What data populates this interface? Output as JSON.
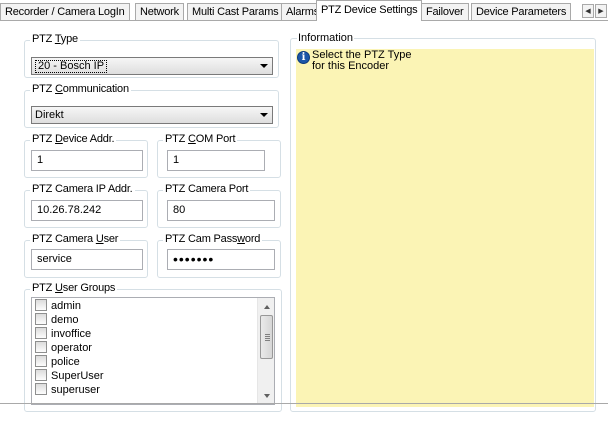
{
  "tabs": [
    {
      "label": "Recorder / Camera LogIn",
      "active": false
    },
    {
      "label": "Network",
      "active": false
    },
    {
      "label": "Multi Cast Params",
      "active": false
    },
    {
      "label": "Alarms",
      "active": false
    },
    {
      "label": "PTZ Device Settings",
      "active": true
    },
    {
      "label": "Failover",
      "active": false
    },
    {
      "label": "Device Parameters",
      "active": false
    }
  ],
  "ptz_type": {
    "title_pre": "PTZ ",
    "title_key": "T",
    "title_post": "ype",
    "value": "20 - Bosch IP"
  },
  "ptz_communication": {
    "title_pre": "PTZ ",
    "title_key": "C",
    "title_post": "ommunication",
    "value": "Direkt"
  },
  "ptz_device_addr": {
    "title_pre": "PTZ ",
    "title_key": "D",
    "title_post": "evice Addr.",
    "value": "1"
  },
  "ptz_com_port": {
    "title_pre": "PTZ ",
    "title_key": "C",
    "title_post": "OM Port",
    "value": "1"
  },
  "ptz_camera_ip": {
    "title": "PTZ Camera IP Addr.",
    "value": "10.26.78.242"
  },
  "ptz_camera_port": {
    "title": "PTZ Camera Port",
    "value": "80"
  },
  "ptz_camera_user": {
    "title_pre": "PTZ Camera ",
    "title_key": "U",
    "title_post": "ser",
    "value": "service"
  },
  "ptz_cam_password": {
    "title_pre": "PTZ Cam Pass",
    "title_key": "w",
    "title_post": "ord",
    "value": "•••••••"
  },
  "ptz_user_groups": {
    "title_pre": "PTZ ",
    "title_key": "U",
    "title_post": "ser Groups",
    "items": [
      "admin",
      "demo",
      "invoffice",
      "operator",
      "police",
      "SuperUser",
      "superuser"
    ]
  },
  "information": {
    "title": "Information",
    "line1": "Select the PTZ Type",
    "line2": "for this Encoder",
    "panel_color": "#fbf4b5"
  },
  "icons": {
    "info": "info-icon",
    "scroll_left": "arrow-left-icon",
    "scroll_right": "arrow-right-icon"
  }
}
